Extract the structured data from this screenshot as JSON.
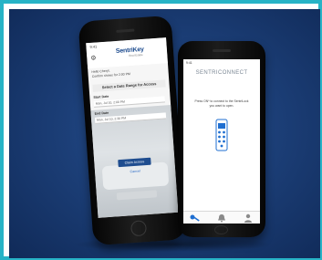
{
  "phone1": {
    "status": "9:41",
    "logo": "SentriKey",
    "logo_sub": "Real Estate",
    "greeting_line1": "Hello Cheryl,",
    "greeting_line2": "Confirm shows for 2:00 PM",
    "title": "Select a Date Range for Access",
    "start_label": "Start Date",
    "start_value": "Mon, Jul 10, 2:00 PM",
    "end_label": "End Date",
    "end_value": "Mon, Jul 10, 2:30 PM",
    "button": "Claim Access",
    "cancel": "Cancel"
  },
  "phone2": {
    "status": "9:41",
    "logo": "SENTRICONNECT",
    "message": "Press ON* to connect to the SentriLock you want to open.",
    "tabs": [
      "key-icon",
      "bell-icon",
      "person-icon"
    ],
    "accent": "#1f6fd1"
  },
  "colors": {
    "border": "#27b3c6",
    "background": "#1c3f78",
    "brand": "#1f4d8f"
  }
}
